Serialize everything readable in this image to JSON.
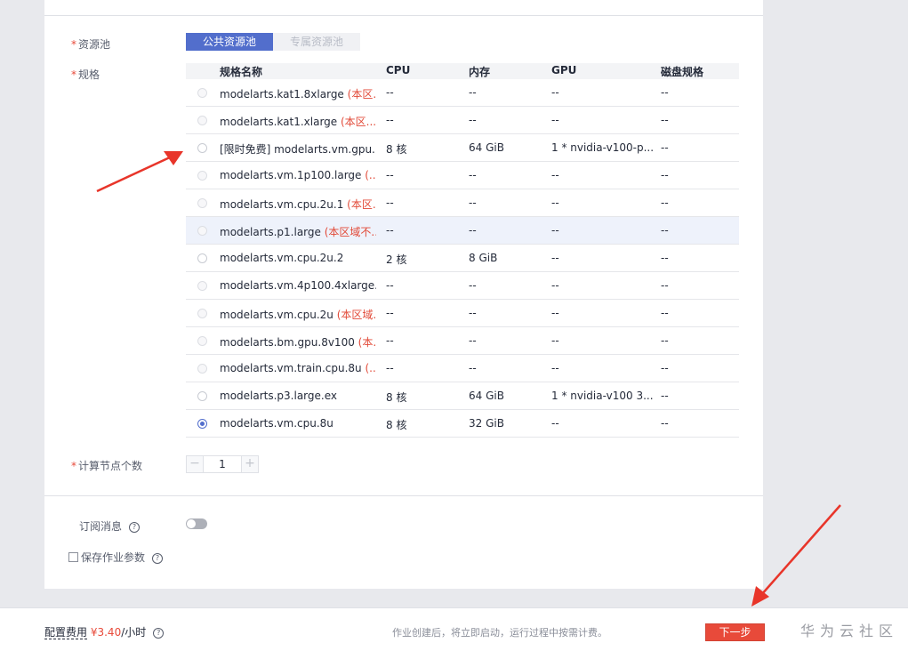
{
  "form": {
    "pool_label": "资源池",
    "spec_label": "规格",
    "nodes_label": "计算节点个数",
    "required_mark": "*",
    "pool_options": [
      "公共资源池",
      "专属资源池"
    ],
    "node_count": "1",
    "stepper_minus": "−",
    "stepper_plus": "+",
    "subscribe_label": "订阅消息",
    "save_params_label": "保存作业参数",
    "help_glyph": "?"
  },
  "table": {
    "headers": [
      "规格名称",
      "CPU",
      "内存",
      "GPU",
      "磁盘规格"
    ],
    "rows": [
      {
        "name": "modelarts.kat1.8xlarge ",
        "note": "(本区...",
        "cpu": "--",
        "mem": "--",
        "gpu": "--",
        "disk": "--",
        "state": "disabled"
      },
      {
        "name": "modelarts.kat1.xlarge ",
        "note": "(本区...",
        "cpu": "--",
        "mem": "--",
        "gpu": "--",
        "disk": "--",
        "state": "disabled"
      },
      {
        "name": "[限时免费] modelarts.vm.gpu...",
        "note": "",
        "cpu": "8 核",
        "mem": "64 GiB",
        "gpu": "1 * nvidia-v100-p...",
        "disk": "--",
        "state": "enabled"
      },
      {
        "name": "modelarts.vm.1p100.large ",
        "note": "(...",
        "cpu": "--",
        "mem": "--",
        "gpu": "--",
        "disk": "--",
        "state": "disabled"
      },
      {
        "name": "modelarts.vm.cpu.2u.1 ",
        "note": "(本区...",
        "cpu": "--",
        "mem": "--",
        "gpu": "--",
        "disk": "--",
        "state": "disabled"
      },
      {
        "name": "modelarts.p1.large ",
        "note": "(本区域不...",
        "cpu": "--",
        "mem": "--",
        "gpu": "--",
        "disk": "--",
        "state": "disabled"
      },
      {
        "name": "modelarts.vm.cpu.2u.2",
        "note": "",
        "cpu": "2 核",
        "mem": "8 GiB",
        "gpu": "--",
        "disk": "--",
        "state": "enabled"
      },
      {
        "name": "modelarts.vm.4p100.4xlarge...",
        "note": "",
        "cpu": "--",
        "mem": "--",
        "gpu": "--",
        "disk": "--",
        "state": "disabled"
      },
      {
        "name": "modelarts.vm.cpu.2u ",
        "note": "(本区域...",
        "cpu": "--",
        "mem": "--",
        "gpu": "--",
        "disk": "--",
        "state": "disabled"
      },
      {
        "name": "modelarts.bm.gpu.8v100 ",
        "note": "(本...",
        "cpu": "--",
        "mem": "--",
        "gpu": "--",
        "disk": "--",
        "state": "disabled"
      },
      {
        "name": "modelarts.vm.train.cpu.8u ",
        "note": "(...",
        "cpu": "--",
        "mem": "--",
        "gpu": "--",
        "disk": "--",
        "state": "disabled"
      },
      {
        "name": "modelarts.p3.large.ex",
        "note": "",
        "cpu": "8 核",
        "mem": "64 GiB",
        "gpu": "1 * nvidia-v100 3...",
        "disk": "--",
        "state": "enabled"
      },
      {
        "name": "modelarts.vm.cpu.8u",
        "note": "",
        "cpu": "8 核",
        "mem": "32 GiB",
        "gpu": "--",
        "disk": "--",
        "state": "checked"
      }
    ]
  },
  "footer": {
    "cost_label": "配置费用",
    "price": "¥3.40",
    "unit": "/小时",
    "notice": "作业创建后，将立即启动，运行过程中按需计费。",
    "next_button": "下一步",
    "watermark": "华为云社区"
  },
  "colors": {
    "primary": "#526ecc",
    "danger": "#e84a3a",
    "arrow": "#e8352a"
  }
}
